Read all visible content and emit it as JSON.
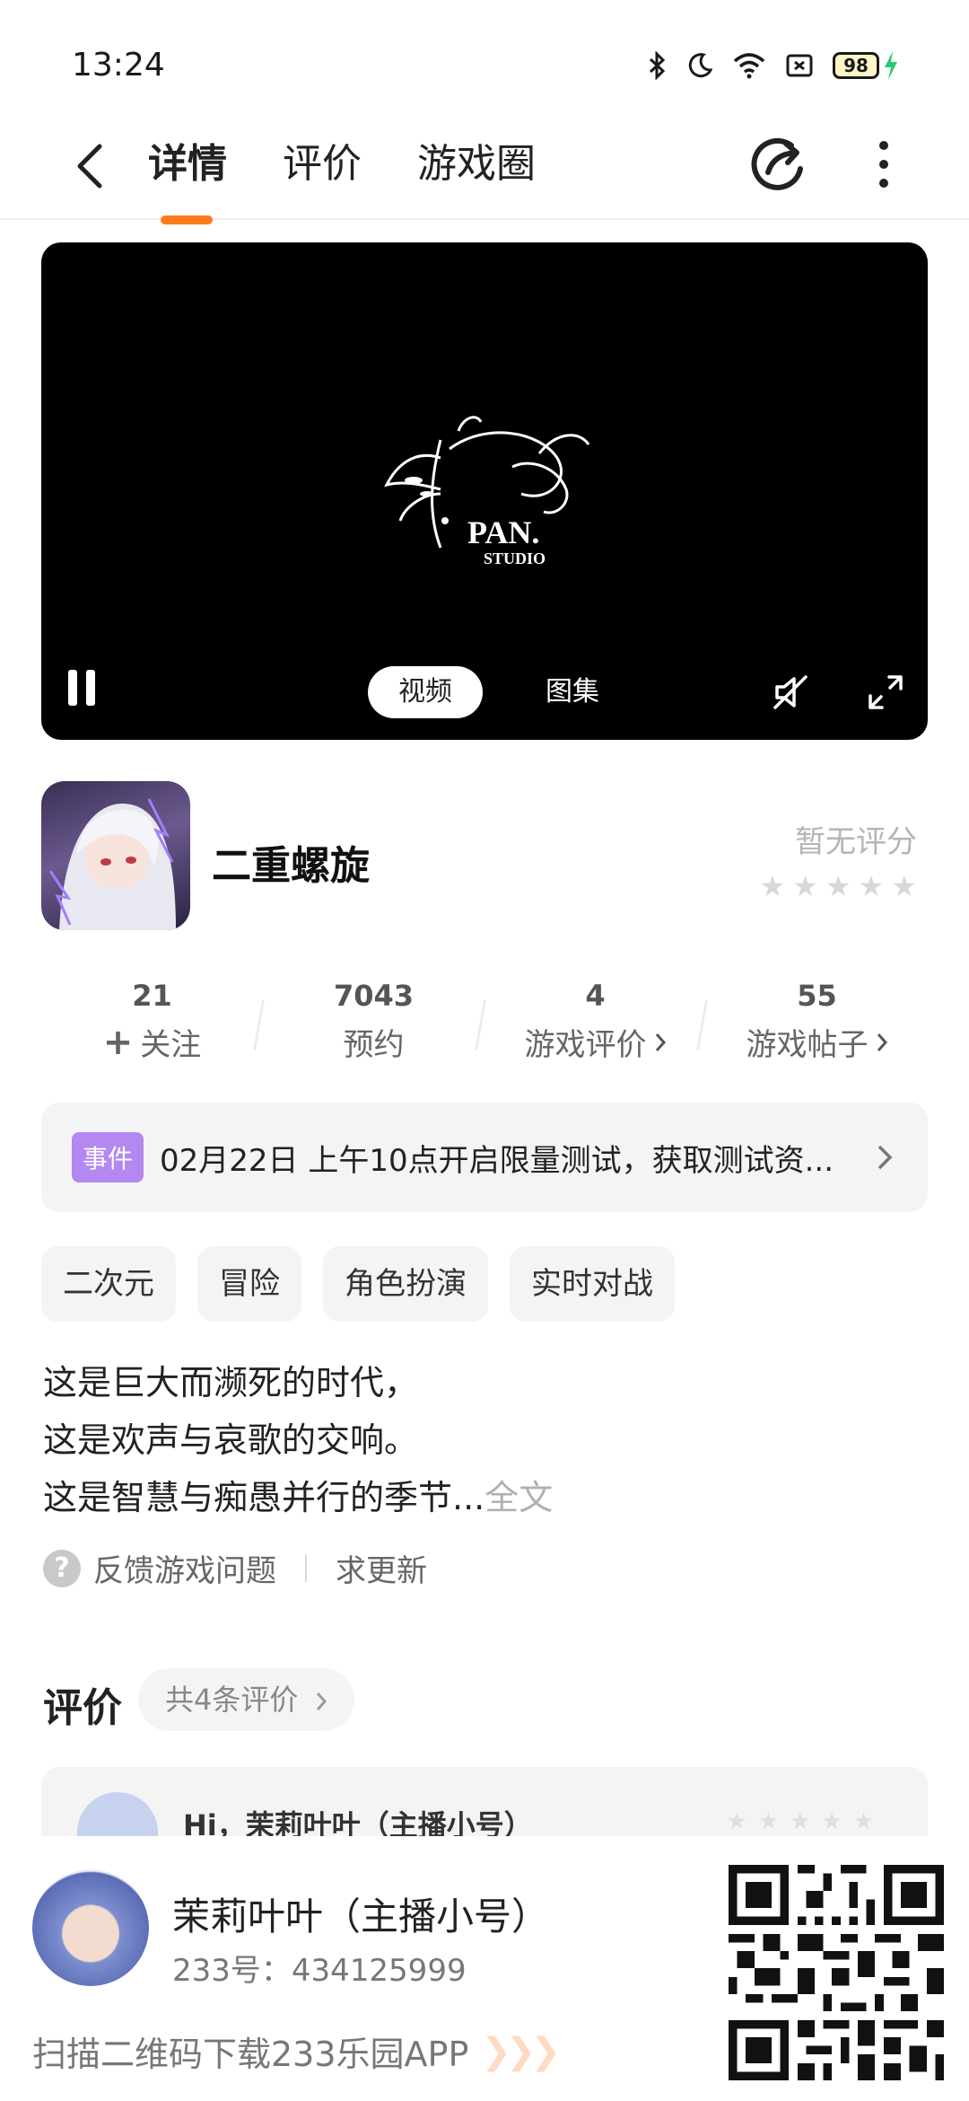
{
  "status_bar": {
    "time": "13:24",
    "battery": "98",
    "icons": [
      "bluetooth-icon",
      "moon-icon",
      "wifi-icon",
      "sim-icon",
      "battery-icon",
      "charging-icon"
    ]
  },
  "nav": {
    "tabs": [
      {
        "label": "详情",
        "active": true
      },
      {
        "label": "评价",
        "active": false
      },
      {
        "label": "游戏圈",
        "active": false
      }
    ],
    "accent": "#ff7a1a"
  },
  "video": {
    "tabs": [
      {
        "label": "视频",
        "active": true
      },
      {
        "label": "图集",
        "active": false
      }
    ]
  },
  "game": {
    "name": "二重螺旋",
    "rating_text": "暂无评分",
    "stars": 5
  },
  "stats": [
    {
      "value": "21",
      "label": "关注",
      "prefix": "+"
    },
    {
      "value": "7043",
      "label": "预约"
    },
    {
      "value": "4",
      "label": "游戏评价",
      "arrow": true
    },
    {
      "value": "55",
      "label": "游戏帖子",
      "arrow": true
    }
  ],
  "event": {
    "badge": "事件",
    "text": "02月22日  上午10点开启限量测试，获取测试资..."
  },
  "tags": [
    "二次元",
    "冒险",
    "角色扮演",
    "实时对战"
  ],
  "description": {
    "lines": [
      "这是巨大而濒死的时代，",
      "这是欢声与哀歌的交响。",
      "这是智慧与痴愚并行的季节..."
    ],
    "more": "全文"
  },
  "feedback": {
    "report": "反馈游戏问题",
    "update": "求更新"
  },
  "reviews": {
    "title": "评价",
    "count_label": "共4条评价",
    "first_user": "Hi，茉莉叶叶（主播小号）"
  },
  "bottom_panel": {
    "name": "茉莉叶叶（主播小号）",
    "id": "233号：434125999",
    "download": "扫描二维码下载233乐园APP"
  }
}
